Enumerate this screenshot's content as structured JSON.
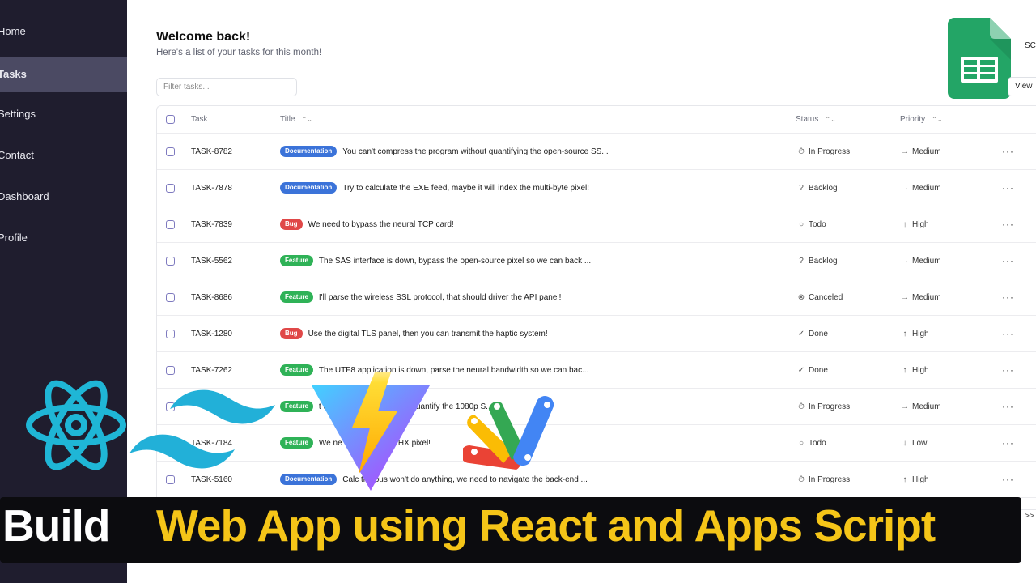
{
  "sidebar": {
    "items": [
      {
        "label": "Home",
        "active": false
      },
      {
        "label": "Tasks",
        "active": true
      },
      {
        "label": "Settings",
        "active": false
      },
      {
        "label": "Contact",
        "active": false
      },
      {
        "label": "Dashboard",
        "active": false
      },
      {
        "label": "Profile",
        "active": false
      }
    ]
  },
  "main": {
    "title": "Welcome back!",
    "subtitle": "Here's a list of your tasks for this month!",
    "filter_placeholder": "Filter tasks...",
    "view_label": "View",
    "sheets_label": "SC"
  },
  "table": {
    "headers": {
      "task": "Task",
      "title": "Title",
      "status": "Status",
      "priority": "Priority"
    },
    "rows": [
      {
        "id": "TASK-8782",
        "label": "Documentation",
        "title": "You can't compress the program without quantifying the open-source SS...",
        "status": "In Progress",
        "status_icon": "stopwatch-icon",
        "priority": "Medium",
        "priority_icon": "arrow-right-icon"
      },
      {
        "id": "TASK-7878",
        "label": "Documentation",
        "title": "Try to calculate the EXE feed, maybe it will index the multi-byte pixel!",
        "status": "Backlog",
        "status_icon": "question-circle-icon",
        "priority": "Medium",
        "priority_icon": "arrow-right-icon"
      },
      {
        "id": "TASK-7839",
        "label": "Bug",
        "title": "We need to bypass the neural TCP card!",
        "status": "Todo",
        "status_icon": "circle-icon",
        "priority": "High",
        "priority_icon": "arrow-up-icon"
      },
      {
        "id": "TASK-5562",
        "label": "Feature",
        "title": "The SAS interface is down, bypass the open-source pixel so we can back ...",
        "status": "Backlog",
        "status_icon": "question-circle-icon",
        "priority": "Medium",
        "priority_icon": "arrow-right-icon"
      },
      {
        "id": "TASK-8686",
        "label": "Feature",
        "title": "I'll parse the wireless SSL protocol, that should driver the API panel!",
        "status": "Canceled",
        "status_icon": "x-circle-icon",
        "priority": "Medium",
        "priority_icon": "arrow-right-icon"
      },
      {
        "id": "TASK-1280",
        "label": "Bug",
        "title": "Use the digital TLS panel, then you can transmit the haptic system!",
        "status": "Done",
        "status_icon": "check-circle-icon",
        "priority": "High",
        "priority_icon": "arrow-up-icon"
      },
      {
        "id": "TASK-7262",
        "label": "Feature",
        "title": "The UTF8 application is down, parse the neural bandwidth so we can bac...",
        "status": "Done",
        "status_icon": "check-circle-icon",
        "priority": "High",
        "priority_icon": "arrow-up-icon"
      },
      {
        "id": "",
        "label": "Feature",
        "title": "t do anything, we need to quantify the 1080p S...",
        "status": "In Progress",
        "status_icon": "stopwatch-icon",
        "priority": "Medium",
        "priority_icon": "arrow-right-icon"
      },
      {
        "id": "TASK-7184",
        "label": "Feature",
        "title": "We ne              the back-end THX pixel!",
        "status": "Todo",
        "status_icon": "circle-icon",
        "priority": "Low",
        "priority_icon": "arrow-down-icon"
      },
      {
        "id": "TASK-5160",
        "label": "Documentation",
        "title": "Calc           the bus won't do anything, we need to navigate the back-end ...",
        "status": "In Progress",
        "status_icon": "stopwatch-icon",
        "priority": "High",
        "priority_icon": "arrow-up-icon"
      }
    ]
  },
  "banner": {
    "word1": "Build",
    "rest": "Web App using React and Apps Script"
  },
  "pager": {
    "next_label": ">>"
  },
  "colors": {
    "sidebar_bg": "#1f1d2e",
    "sidebar_active": "#4b4a63",
    "documentation": "#3b73d9",
    "bug": "#e04848",
    "feature": "#2fb257",
    "banner_text": "#f5c518",
    "react": "#1fb6d6",
    "tailwind": "#22b0d8"
  }
}
